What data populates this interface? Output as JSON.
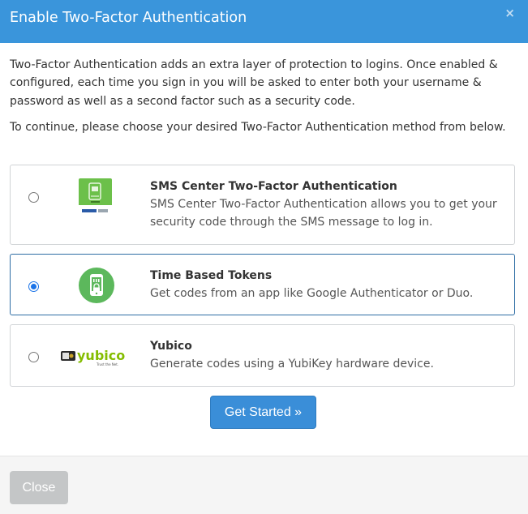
{
  "modal": {
    "title": "Enable Two-Factor Authentication",
    "close_icon": "×",
    "intro": "Two-Factor Authentication adds an extra layer of protection to logins. Once enabled & configured, each time you sign in you will be asked to enter both your username & password as well as a second factor such as a security code.",
    "instruction": "To continue, please choose your desired Two-Factor Authentication method from below."
  },
  "options": [
    {
      "title": "SMS Center Two-Factor Authentication",
      "description": "SMS Center Two-Factor Authentication allows you to get your security code through the SMS message to log in.",
      "selected": false,
      "icon": "sms-center-logo"
    },
    {
      "title": "Time Based Tokens",
      "description": "Get codes from an app like Google Authenticator or Duo.",
      "selected": true,
      "icon": "phone-lock-logo"
    },
    {
      "title": "Yubico",
      "description": "Generate codes using a YubiKey hardware device.",
      "selected": false,
      "icon": "yubico-logo",
      "logo_text": "yubico",
      "logo_tagline": "Trust the Net."
    }
  ],
  "actions": {
    "get_started_label": "Get Started »",
    "close_label": "Close"
  },
  "colors": {
    "header": "#3a95db",
    "primary_button": "#3a8ed8",
    "disabled_button": "#c4c6c7",
    "sms_logo_green": "#6cc04a",
    "totp_logo_green": "#5cb85c",
    "yubico_green": "#84bd00"
  }
}
